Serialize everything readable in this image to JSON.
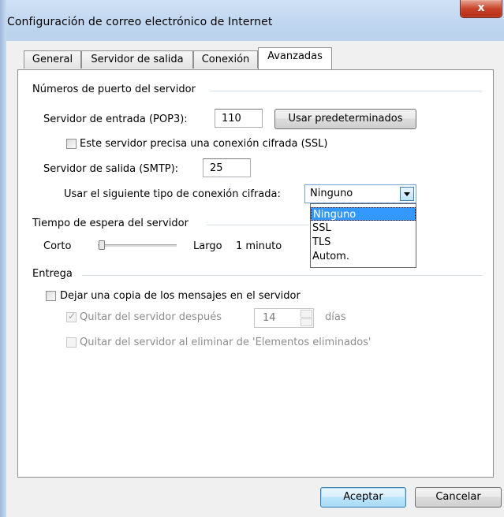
{
  "window": {
    "title": "Configuración de correo electrónico de Internet",
    "close_label": "x"
  },
  "tabs": [
    {
      "label": "General"
    },
    {
      "label": "Servidor de salida"
    },
    {
      "label": "Conexión"
    },
    {
      "label": "Avanzadas"
    }
  ],
  "ports": {
    "group_title": "Números de puerto del servidor",
    "incoming_label": "Servidor de entrada (POP3):",
    "incoming_value": "110",
    "defaults_button": "Usar predeterminados",
    "ssl_checkbox_label": "Este servidor precisa una conexión cifrada (SSL)",
    "outgoing_label": "Servidor de salida (SMTP):",
    "outgoing_value": "25",
    "encryption_label": "Usar el siguiente tipo de conexión cifrada:",
    "encryption_selected": "Ninguno",
    "encryption_options": [
      "Ninguno",
      "SSL",
      "TLS",
      "Autom."
    ]
  },
  "timeout": {
    "group_title": "Tiempo de espera del servidor",
    "short_label": "Corto",
    "long_label": "Largo",
    "value_label": "1 minuto"
  },
  "delivery": {
    "group_title": "Entrega",
    "leave_copy_label": "Dejar una copia de los mensajes en el servidor",
    "remove_after_label": "Quitar del servidor después",
    "days_value": "14",
    "days_unit": "días",
    "remove_deleted_label": "Quitar del servidor al eliminar de 'Elementos eliminados'"
  },
  "footer": {
    "ok": "Aceptar",
    "cancel": "Cancelar"
  },
  "colors": {
    "selection": "#3399ff",
    "title_bar": "#c5d9f0",
    "close_button": "#c7432a"
  }
}
